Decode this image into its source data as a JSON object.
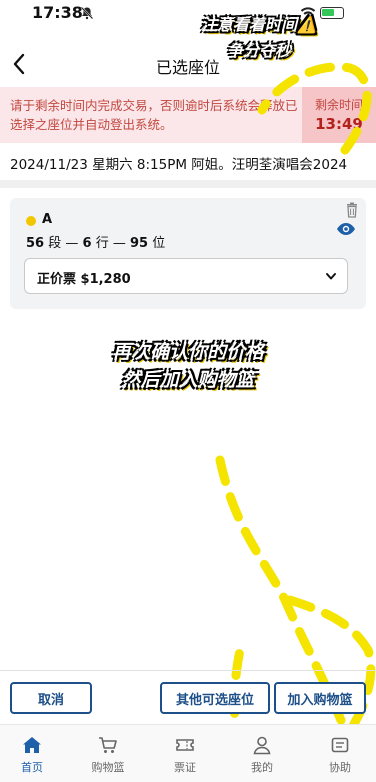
{
  "status_bar": {
    "time": "17:38"
  },
  "header": {
    "title": "已选座位"
  },
  "timer": {
    "message": "请于剩余时间内完成交易，否则逾时后系统会释放已选择之座位并自动登出系统。",
    "label": "剩余时间",
    "value": "13:49"
  },
  "event": {
    "text": "2024/11/23 星期六 8:15PM 阿姐。汪明荃演唱会2024"
  },
  "seat": {
    "section": "A",
    "block": "56",
    "block_unit": "段",
    "row": "6",
    "row_unit": "行",
    "seat_no": "95",
    "seat_unit": "位",
    "dash": "—",
    "price_option": "正价票 $1,280",
    "dot_color": "#f2c700"
  },
  "overlay": {
    "top_line1": "注意看着时间⚠️",
    "top_line2": "争分夺秒",
    "mid_line1": "再次确认你的价格",
    "mid_line2": "然后加入购物篮"
  },
  "actions": {
    "cancel": "取消",
    "other_seats": "其他可选座位",
    "add_to_basket": "加入购物篮"
  },
  "tabs": [
    {
      "label": "首页",
      "icon": "home-icon"
    },
    {
      "label": "购物篮",
      "icon": "cart-icon"
    },
    {
      "label": "票证",
      "icon": "ticket-icon"
    },
    {
      "label": "我的",
      "icon": "user-icon"
    },
    {
      "label": "协助",
      "icon": "help-icon"
    }
  ],
  "colors": {
    "accent": "#1d4f88",
    "alert_bg": "#fbe7e9",
    "alert_text": "#c2473f",
    "timer_text": "#b3211d"
  }
}
